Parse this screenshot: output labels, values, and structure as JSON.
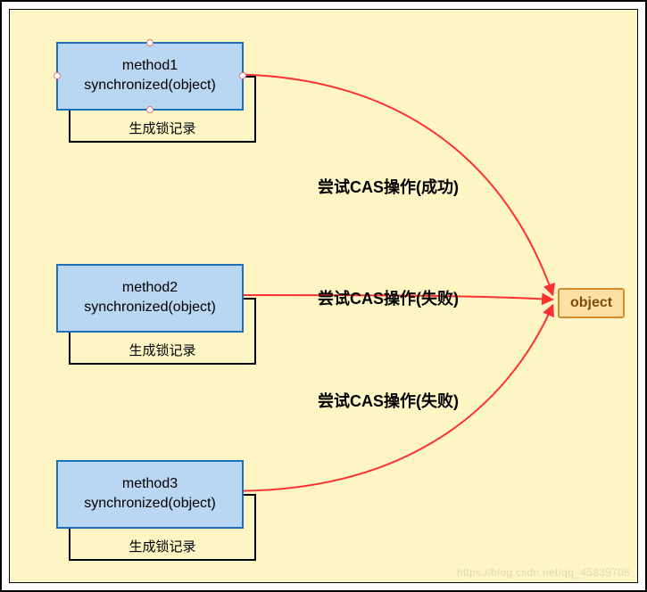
{
  "diagram": {
    "methods": [
      {
        "line1": "method1",
        "line2": "synchronized(object)",
        "record_label": "生成锁记录",
        "edge_label": "尝试CAS操作(成功)",
        "show_handles": true
      },
      {
        "line1": "method2",
        "line2": "synchronized(object)",
        "record_label": "生成锁记录",
        "edge_label": "尝试CAS操作(失败)",
        "show_handles": false
      },
      {
        "line1": "method3",
        "line2": "synchronized(object)",
        "record_label": "生成锁记录",
        "edge_label": "尝试CAS操作(失败)",
        "show_handles": false
      }
    ],
    "target": {
      "label": "object"
    },
    "colors": {
      "canvas_bg": "#fdf6c4",
      "method_fill": "#b9d6f2",
      "method_border": "#1e6fb8",
      "object_fill": "#ffe0a3",
      "object_border": "#d98c2b",
      "connector": "#ff3030"
    },
    "watermark": "https://blog.csdn.net/qq_45839708"
  }
}
